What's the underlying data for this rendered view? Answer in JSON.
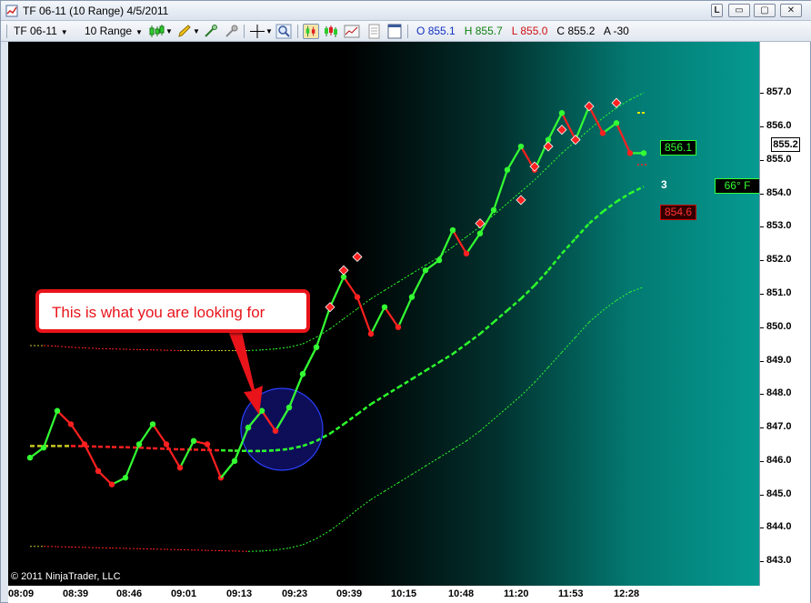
{
  "window": {
    "title": "TF 06-11 (10 Range)  4/5/2011",
    "controls": {
      "link": "L",
      "minimize": "▭",
      "maximize": "▢",
      "close": "✕"
    }
  },
  "toolbar": {
    "instrument": "TF 06-11",
    "interval": "10 Range",
    "ohlc": {
      "open_label": "O",
      "open": "855.1",
      "high_label": "H",
      "high": "855.7",
      "low_label": "L",
      "low": "855.0",
      "close_label": "C",
      "close": "855.2",
      "a_label": "A",
      "a": "-30"
    },
    "icons": [
      "candlestick-style-icon",
      "pencil-draw-icon",
      "magic-wand-icon",
      "pin-icon",
      "crosshair-icon",
      "zoom-icon",
      "bar-type-icon",
      "indicators-icon",
      "strategies-icon",
      "properties-icon",
      "data-box-icon"
    ]
  },
  "chart_data": {
    "type": "line",
    "y_ticks": [
      "843.0",
      "844.0",
      "845.0",
      "846.0",
      "847.0",
      "848.0",
      "849.0",
      "850.0",
      "851.0",
      "852.0",
      "853.0",
      "854.0",
      "855.0",
      "856.0",
      "857.0"
    ],
    "x_ticks": [
      "08:09",
      "08:39",
      "08:46",
      "09:01",
      "09:13",
      "09:23",
      "09:39",
      "10:15",
      "10:48",
      "11:20",
      "11:53",
      "12:28"
    ],
    "ylim": [
      842.6,
      858.2
    ],
    "price_series": [
      846.1,
      846.4,
      847.5,
      847.1,
      846.5,
      845.7,
      845.3,
      845.5,
      846.5,
      847.1,
      846.5,
      845.8,
      846.6,
      846.5,
      845.5,
      846.0,
      847.0,
      847.5,
      846.9,
      847.6,
      848.6,
      849.4,
      850.6,
      851.5,
      850.9,
      849.8,
      850.6,
      850.0,
      850.9,
      851.7,
      852.0,
      852.9,
      852.2,
      852.8,
      853.5,
      854.7,
      855.4,
      854.7,
      855.6,
      856.4,
      855.6,
      856.6,
      855.8,
      856.1,
      855.2,
      855.2
    ],
    "up_markers": [
      5,
      14,
      15,
      25,
      28,
      30,
      31,
      32,
      36,
      43
    ],
    "diamond_markers": [
      {
        "i": 22,
        "v": 850.6
      },
      {
        "i": 23,
        "v": 851.7
      },
      {
        "i": 24,
        "v": 852.1
      },
      {
        "i": 33,
        "v": 853.1
      },
      {
        "i": 36,
        "v": 853.8
      },
      {
        "i": 37,
        "v": 854.8
      },
      {
        "i": 38,
        "v": 855.4
      },
      {
        "i": 39,
        "v": 855.9
      },
      {
        "i": 40,
        "v": 855.6
      },
      {
        "i": 41,
        "v": 856.6
      },
      {
        "i": 43,
        "v": 856.7
      }
    ],
    "upper_band": [
      849.45,
      849.45,
      849.43,
      849.4,
      849.38,
      849.36,
      849.35,
      849.34,
      849.33,
      849.32,
      849.31,
      849.3,
      849.3,
      849.3,
      849.3,
      849.3,
      849.3,
      849.32,
      849.35,
      849.4,
      849.5,
      849.7,
      849.95,
      850.25,
      850.55,
      850.85,
      851.1,
      851.35,
      851.6,
      851.85,
      852.1,
      852.4,
      852.7,
      853.0,
      853.35,
      853.7,
      854.05,
      854.4,
      854.8,
      855.2,
      855.55,
      855.9,
      856.25,
      856.55,
      856.8,
      857.0
    ],
    "mid_band": [
      846.45,
      846.45,
      846.45,
      846.45,
      846.44,
      846.43,
      846.42,
      846.41,
      846.4,
      846.38,
      846.36,
      846.35,
      846.34,
      846.33,
      846.32,
      846.31,
      846.3,
      846.3,
      846.32,
      846.36,
      846.45,
      846.6,
      846.82,
      847.1,
      847.4,
      847.7,
      847.95,
      848.2,
      848.45,
      848.7,
      848.95,
      849.2,
      849.5,
      849.8,
      850.15,
      850.5,
      850.85,
      851.25,
      851.7,
      852.2,
      852.65,
      853.1,
      853.45,
      853.75,
      854.0,
      854.2
    ],
    "lower_band": [
      843.45,
      843.45,
      843.44,
      843.43,
      843.42,
      843.41,
      843.4,
      843.39,
      843.38,
      843.37,
      843.36,
      843.35,
      843.34,
      843.33,
      843.32,
      843.31,
      843.3,
      843.31,
      843.34,
      843.4,
      843.5,
      843.68,
      843.92,
      844.22,
      844.55,
      844.85,
      845.1,
      845.35,
      845.6,
      845.85,
      846.1,
      846.35,
      846.6,
      846.9,
      847.25,
      847.6,
      847.95,
      848.35,
      848.8,
      849.25,
      849.7,
      850.15,
      850.5,
      850.8,
      851.05,
      851.2
    ],
    "colors": {
      "up": "#33ff33",
      "down": "#ff2020",
      "diamond": "#ff2020",
      "band_up": "#2cff2c",
      "band_down": "#ff2020"
    }
  },
  "annotations": {
    "callout": "This is what you are looking for",
    "upper_value": "856.1",
    "lower_value": "854.6",
    "temperature": "66°  F",
    "count": "3",
    "current_price": "855.2",
    "copyright": "© 2011 NinjaTrader, LLC"
  }
}
